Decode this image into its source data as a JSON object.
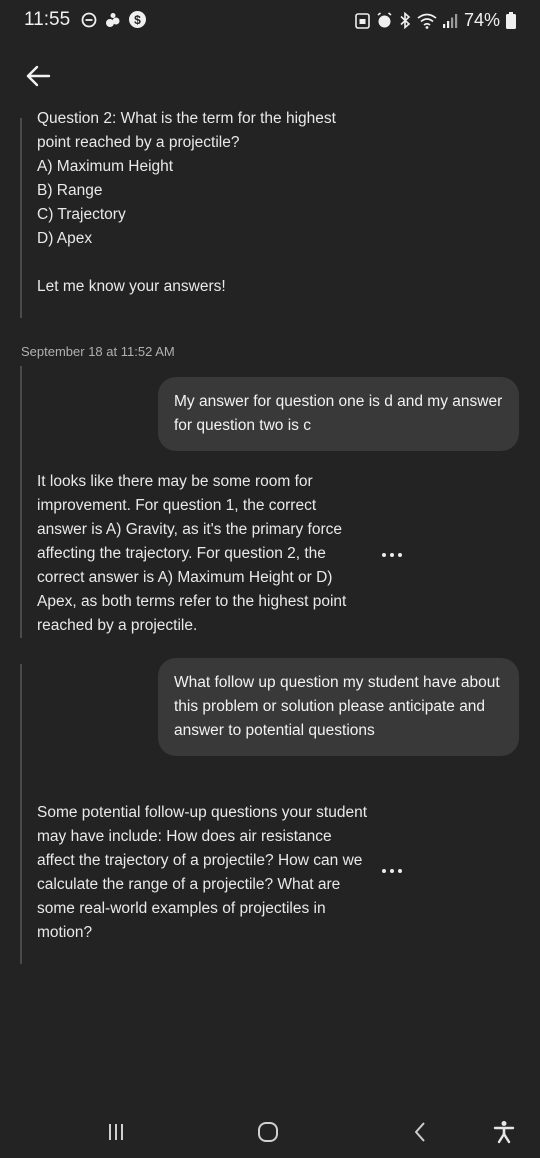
{
  "status_bar": {
    "time": "11:55",
    "battery": "74%"
  },
  "header": {
    "back_icon": "arrow-left-icon"
  },
  "messages": {
    "bot_1": "Question 2: What is the term for the highest point reached by a projectile?\nA) Maximum Height\nB) Range\nC) Trajectory\nD) Apex\n\nLet me know your answers!",
    "timestamp": "September 18 at 11:52 AM",
    "user_1": "My answer for question one is d and my answer for question two is c",
    "bot_2": "It looks like there may be some room for improvement. For question 1, the correct answer is A) Gravity, as it's the primary force affecting the trajectory. For question 2, the correct answer is A) Maximum Height or D) Apex, as both terms refer to the highest point reached by a projectile.",
    "user_2": "What follow up question my student have about this problem or solution please anticipate and answer to potential questions",
    "bot_3": "Some potential follow-up questions your student may have include: How does air resistance affect the trajectory of a projectile? How can we calculate the range of a projectile? What are some real-world examples of projectiles in motion?"
  },
  "nav_bar": {
    "recent_icon": "recent-apps-icon",
    "home_icon": "home-icon",
    "back_icon": "nav-back-icon",
    "accessibility_icon": "accessibility-icon"
  }
}
